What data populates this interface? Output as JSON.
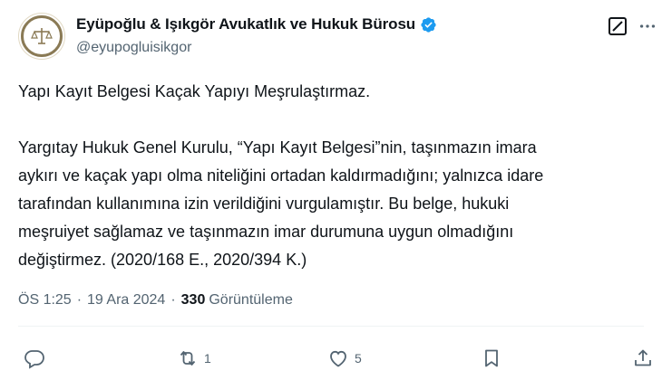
{
  "author": {
    "display_name": "Eyüpoğlu & Işıkgör Avukatlık ve Hukuk Bürosu",
    "handle": "@eyupogluisikgor",
    "verified": true
  },
  "tweet": {
    "text": "Yapı Kayıt Belgesi Kaçak Yapıyı Meşrulaştırmaz.\n\nYargıtay Hukuk Genel Kurulu, “Yapı Kayıt Belgesi”nin, taşınmazın imara\naykırı ve kaçak yapı olma niteliğini ortadan kaldırmadığını; yalnızca idare\ntarafından kullanımına izin verildiğini vurgulamıştır. Bu belge, hukuki\nmeşruiyet sağlamaz ve taşınmazın imar durumuna uygun olmadığını\ndeğiştirmez. (2020/168 E., 2020/394 K.)",
    "time": "ÖS 1:25",
    "date": "19 Ara 2024",
    "views_count": "330",
    "views_label": "Görüntüleme"
  },
  "actions": {
    "reply_count": "",
    "retweet_count": "1",
    "like_count": "5"
  },
  "icons": [
    "avatar-logo",
    "verified-badge-icon",
    "grok-icon",
    "more-icon",
    "reply-icon",
    "retweet-icon",
    "like-icon",
    "bookmark-icon",
    "share-icon"
  ],
  "colors": {
    "text": "#0f1419",
    "secondary": "#536471",
    "verified": "#1d9bf0",
    "divider": "#eff3f4"
  }
}
